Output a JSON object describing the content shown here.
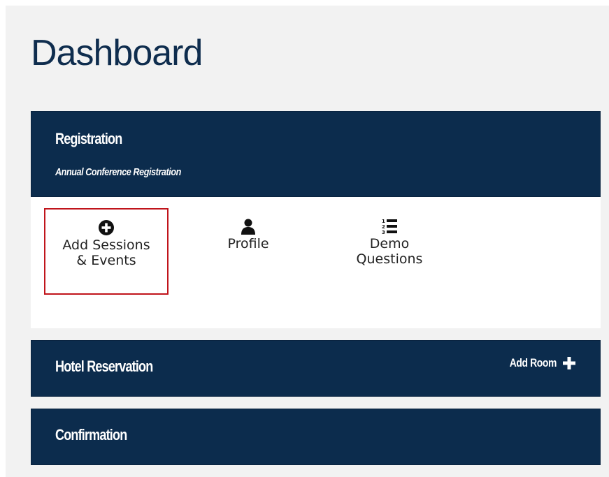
{
  "page": {
    "title": "Dashboard"
  },
  "registration": {
    "title": "Registration",
    "subtitle": "Annual Conference Registration",
    "actions": [
      {
        "label": "Add Sessions\n& Events",
        "icon": "plus-circle-icon"
      },
      {
        "label": "Profile",
        "icon": "user-icon"
      },
      {
        "label": "Demo\nQuestions",
        "icon": "numbered-list-icon"
      }
    ]
  },
  "hotel": {
    "title": "Hotel Reservation",
    "add_room_label": "Add Room",
    "add_room_icon": "plus-icon"
  },
  "confirmation": {
    "title": "Confirmation"
  },
  "colors": {
    "header_bg": "#0c2c4d",
    "title_text": "#0f2d4e",
    "highlight_border": "#c0141b",
    "content_bg": "#f2f2f2"
  }
}
